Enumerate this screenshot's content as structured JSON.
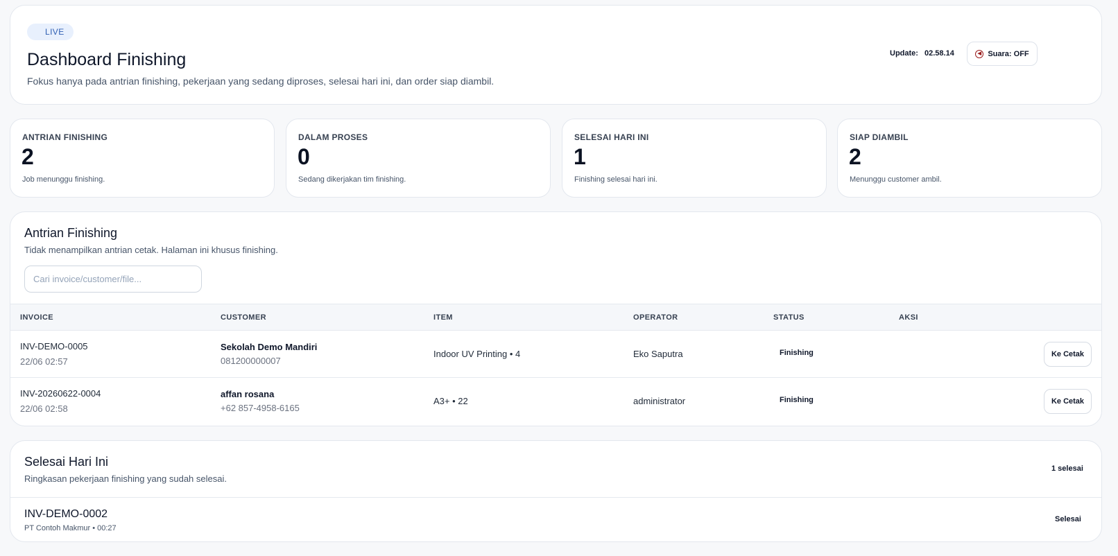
{
  "header": {
    "badge": "LIVE",
    "title": "Dashboard Finishing",
    "subtitle": "Fokus hanya pada antrian finishing, pekerjaan yang sedang diproses, selesai hari ini, dan order siap diambil.",
    "update_label": "Update:",
    "update_value": "02.58.14",
    "sound_label": "Suara: OFF",
    "sound_icon": "sound-off-icon"
  },
  "stats": [
    {
      "label": "ANTRIAN FINISHING",
      "value": "2",
      "desc": "Job menunggu finishing."
    },
    {
      "label": "DALAM PROSES",
      "value": "0",
      "desc": "Sedang dikerjakan tim finishing."
    },
    {
      "label": "SELESAI HARI INI",
      "value": "1",
      "desc": "Finishing selesai hari ini."
    },
    {
      "label": "SIAP DIAMBIL",
      "value": "2",
      "desc": "Menunggu customer ambil."
    }
  ],
  "queue": {
    "title": "Antrian Finishing",
    "subtitle": "Tidak menampilkan antrian cetak. Halaman ini khusus finishing.",
    "search_placeholder": "Cari invoice/customer/file...",
    "search_value": "",
    "columns": [
      "INVOICE",
      "CUSTOMER",
      "ITEM",
      "OPERATOR",
      "STATUS",
      "AKSI"
    ],
    "rows": [
      {
        "invoice": "INV-DEMO-0005",
        "date": "22/06 02:57",
        "customer": "Sekolah Demo Mandiri",
        "phone": "081200000007",
        "item": "Indoor UV Printing • 4",
        "operator": "Eko Saputra",
        "status": "Finishing",
        "action": "Ke Cetak"
      },
      {
        "invoice": "INV-20260622-0004",
        "date": "22/06 02:58",
        "customer": "affan rosana",
        "phone": "+62 857-4958-6165",
        "item": "A3+ • 22",
        "operator": "administrator",
        "status": "Finishing",
        "action": "Ke Cetak"
      }
    ]
  },
  "done": {
    "title": "Selesai Hari Ini",
    "subtitle": "Ringkasan pekerjaan finishing yang sudah selesai.",
    "count_label": "1 selesai",
    "items": [
      {
        "invoice": "INV-DEMO-0002",
        "meta": "PT Contoh Makmur • 00:27",
        "status": "Selesai"
      }
    ]
  },
  "colors": {
    "accent_live": "#2f5fb3",
    "live_bg": "#e8f0fd",
    "sound_icon": "#9a1c1c"
  }
}
